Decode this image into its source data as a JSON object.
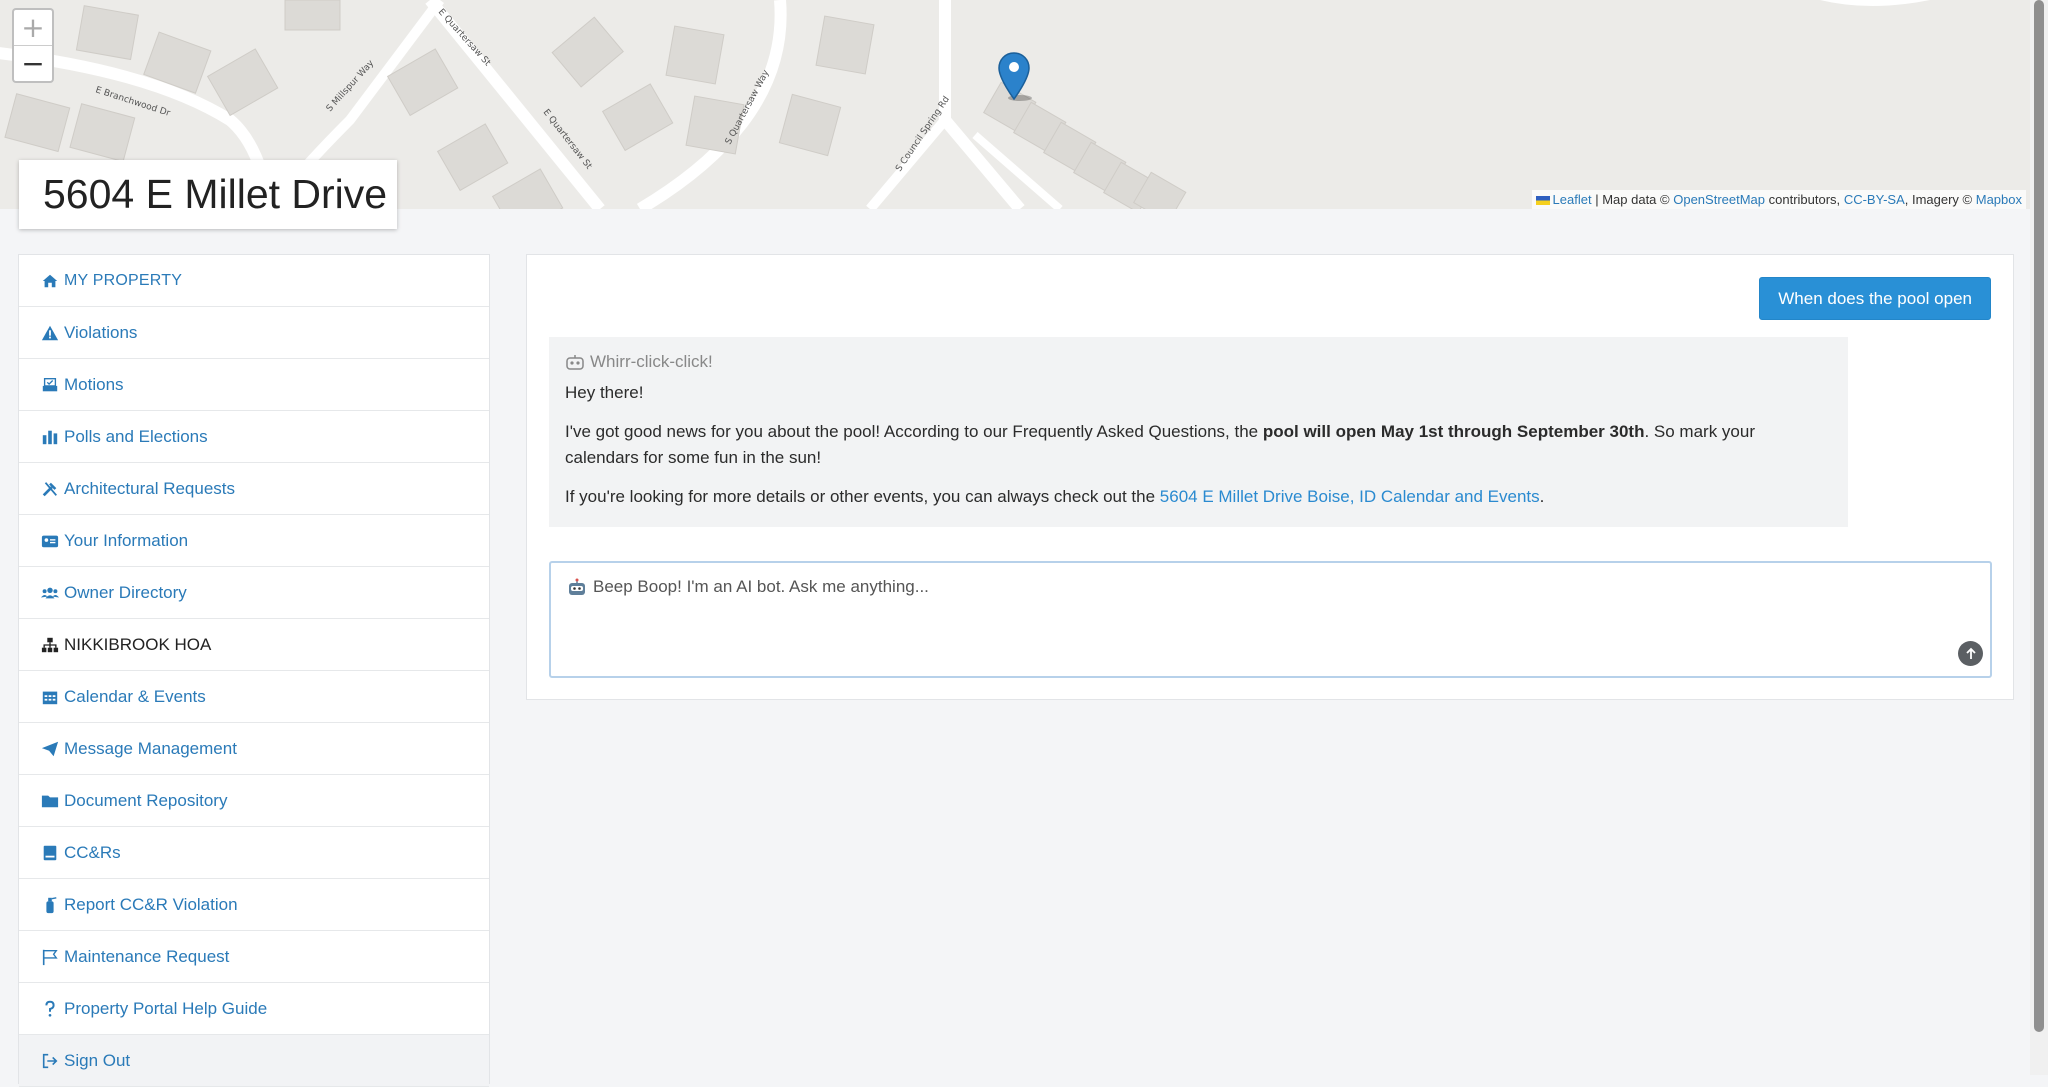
{
  "property": {
    "title": "5604 E Millet Drive"
  },
  "map": {
    "zoom_in": "+",
    "zoom_out": "−",
    "street_labels": [
      "E Branchwood Dr",
      "E Quartersaw St",
      "S Millspur Way",
      "E Quartersaw St",
      "S Quartersaw Way",
      "S Council Spring Rd"
    ],
    "attribution": {
      "leaflet": "Leaflet",
      "map_data": "| Map data ©",
      "osm": "OpenStreetMap",
      "contributors": "contributors,",
      "license": "CC-BY-SA",
      "imagery": ", Imagery ©",
      "mapbox": "Mapbox"
    }
  },
  "sidebar": {
    "items": [
      {
        "label": "MY PROPERTY",
        "icon": "home-icon"
      },
      {
        "label": "Violations",
        "icon": "warning-icon"
      },
      {
        "label": "Motions",
        "icon": "inbox-check-icon"
      },
      {
        "label": "Polls and Elections",
        "icon": "vote-icon"
      },
      {
        "label": "Architectural Requests",
        "icon": "tools-icon"
      },
      {
        "label": "Your Information",
        "icon": "id-card-icon"
      },
      {
        "label": "Owner Directory",
        "icon": "users-icon"
      },
      {
        "label": "NIKKIBROOK HOA",
        "icon": "sitemap-icon"
      },
      {
        "label": "Calendar & Events",
        "icon": "calendar-icon"
      },
      {
        "label": "Message Management",
        "icon": "paper-plane-icon"
      },
      {
        "label": "Document Repository",
        "icon": "folder-icon"
      },
      {
        "label": "CC&Rs",
        "icon": "book-icon"
      },
      {
        "label": "Report CC&R Violation",
        "icon": "fire-extinguisher-icon"
      },
      {
        "label": "Maintenance Request",
        "icon": "flag-icon"
      },
      {
        "label": "Property Portal Help Guide",
        "icon": "question-icon"
      },
      {
        "label": "Sign Out",
        "icon": "sign-out-icon"
      }
    ]
  },
  "chat": {
    "user_question": "When does the pool open",
    "bot_name": "Whirr-click-click!",
    "greeting": "Hey there!",
    "answer_before": "I've got good news for you about the pool! According to our Frequently Asked Questions, the ",
    "answer_bold": "pool will open May 1st through September 30th",
    "answer_after": ". So mark your calendars for some fun in the sun!",
    "more_before": "If you're looking for more details or other events, you can always check out the ",
    "more_link": "5604 E Millet Drive Boise, ID Calendar and Events",
    "more_after": ".",
    "input_placeholder": "Beep Boop! I'm an AI bot. Ask me anything..."
  },
  "colors": {
    "accent": "#2990d6",
    "link": "#2a7ab8",
    "marker": "#2b82cb"
  }
}
